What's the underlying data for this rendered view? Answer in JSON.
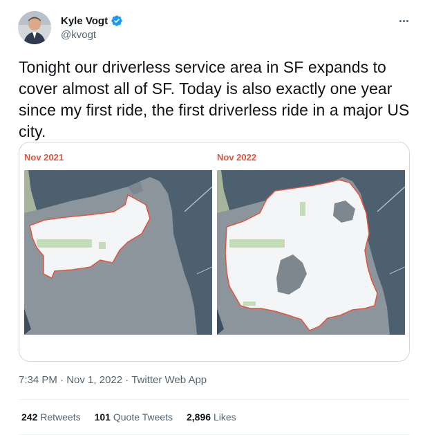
{
  "author": {
    "name": "Kyle Vogt",
    "handle": "@kvogt",
    "verified": true,
    "verified_color": "#1d9bf0"
  },
  "tweet": {
    "text": "Tonight our driverless service area in SF expands to cover almost all of SF. Today is also exactly one year since my first ride, the first driverless ride in a major US city."
  },
  "media": {
    "left_label": "Nov 2021",
    "right_label": "Nov 2022",
    "label_color": "#e2533d",
    "water_color": "#4c6070",
    "land_color": "#8d959c",
    "service_area_color": "#f4f5f6"
  },
  "meta": {
    "time": "7:34 PM",
    "separator": "·",
    "date": "Nov 1, 2022",
    "source": "Twitter Web App"
  },
  "stats": {
    "retweets_count": "242",
    "retweets_label": "Retweets",
    "quotes_count": "101",
    "quotes_label": "Quote Tweets",
    "likes_count": "2,896",
    "likes_label": "Likes"
  },
  "icons": {
    "verified": "verified-badge-icon",
    "more": "more-options-icon"
  }
}
